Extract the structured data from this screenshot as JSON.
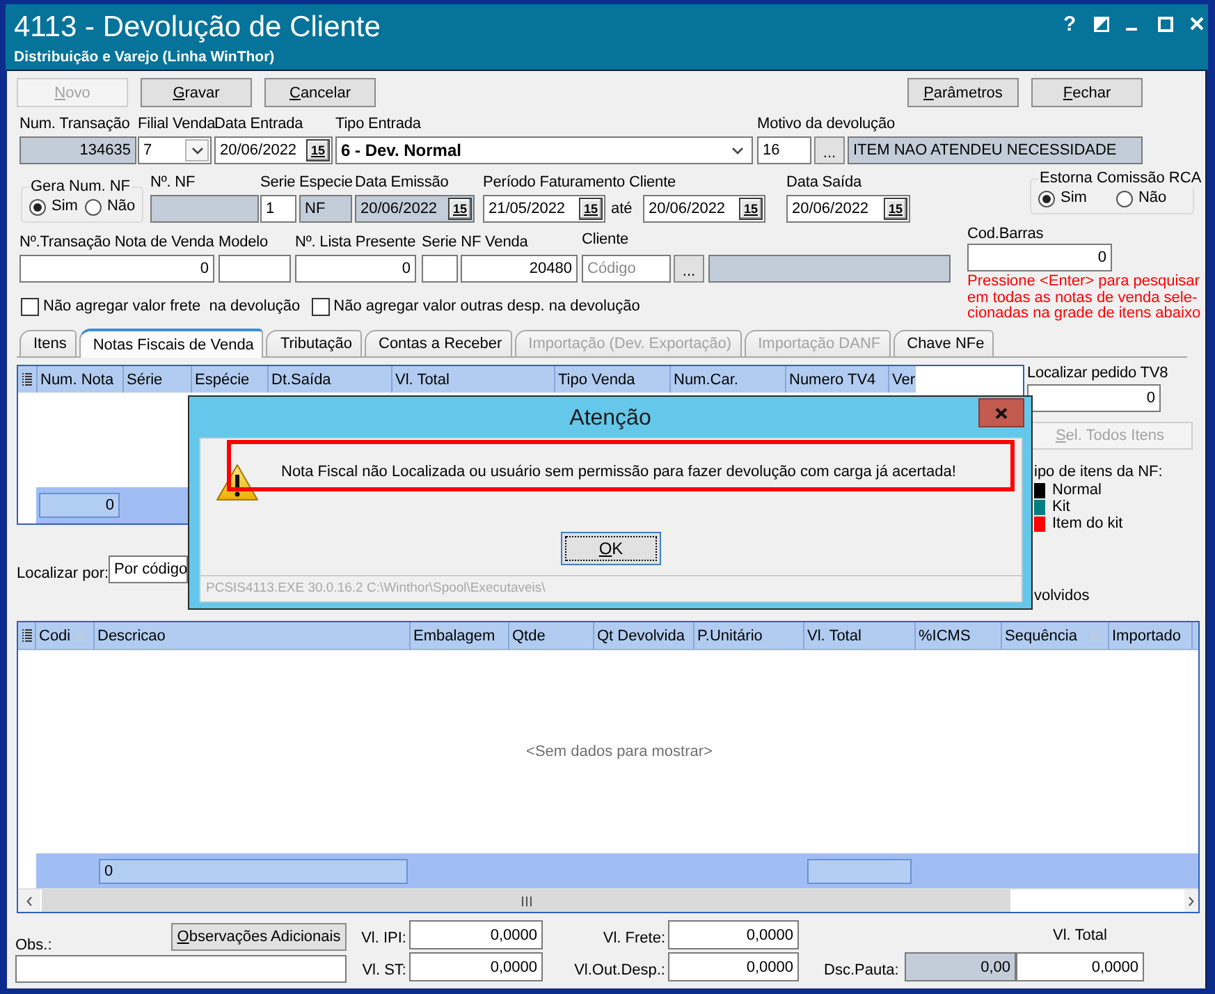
{
  "window": {
    "title": "4113 - Devolução de Cliente",
    "subtitle": "Distribuição e Varejo (Linha WinThor)",
    "controls": [
      {
        "kind": "help",
        "glyph": "?"
      },
      {
        "kind": "contrast"
      },
      {
        "kind": "minimize"
      },
      {
        "kind": "maximize"
      },
      {
        "kind": "close"
      }
    ]
  },
  "toolbar": {
    "left": [
      {
        "label": "Novo",
        "disabled": true,
        "mnemonic": true
      },
      {
        "label": "Gravar",
        "disabled": false,
        "mnemonic": true
      },
      {
        "label": "Cancelar",
        "disabled": false,
        "mnemonic": true
      }
    ],
    "right": [
      {
        "label": "Parâmetros",
        "disabled": false,
        "mnemonic": true
      },
      {
        "label": "Fechar",
        "disabled": false,
        "mnemonic": true
      }
    ]
  },
  "document": {
    "transaction": {
      "label": "Num. Transação",
      "value": "134635",
      "readonly": true
    },
    "branch": {
      "label": "Filial Venda",
      "value": "7"
    },
    "entry_date": {
      "label": "Data Entrada",
      "value": "20/06/2022",
      "calendar": "15"
    },
    "entry_type": {
      "label": "Tipo Entrada",
      "value": "6 - Dev. Normal"
    },
    "reason": {
      "label": "Motivo da devolução",
      "code": "16",
      "button": "...",
      "description": "ITEM NAO ATENDEU NECESSIDADE"
    }
  },
  "invoice": {
    "generate_number": {
      "title": "Gera Num. NF",
      "options": [
        {
          "label": "Sim",
          "selected": true
        },
        {
          "label": "Não",
          "selected": false
        }
      ]
    },
    "number": {
      "label": "Nº. NF",
      "readonly": true
    },
    "series": {
      "label": "Serie",
      "value": "1"
    },
    "species": {
      "label": "Especie",
      "value": "NF",
      "readonly": true
    },
    "issue_date": {
      "label": "Data Emissão",
      "value": "20/06/2022",
      "calendar": "15",
      "readonly": true
    },
    "billing_period": {
      "label": "Período Faturamento Cliente",
      "from": {
        "value": "21/05/2022",
        "calendar": "15"
      },
      "separator": "até",
      "to": {
        "value": "20/06/2022",
        "calendar": "15"
      }
    },
    "exit_date": {
      "label": "Data Saída",
      "value": "20/06/2022",
      "calendar": "15"
    },
    "reverse_commission": {
      "title": "Estorna Comissão RCA",
      "options": [
        {
          "label": "Sim",
          "selected": true
        },
        {
          "label": "Não",
          "selected": false
        }
      ]
    }
  },
  "sale": {
    "transaction": {
      "label": "Nº.Transação Nota de Venda",
      "value": "0"
    },
    "model": {
      "label": "Modelo"
    },
    "gift_list": {
      "label": "Nº. Lista Presente",
      "value": "0"
    },
    "sale_invoice": {
      "label": "Serie NF Venda",
      "value": "20480"
    },
    "customer": {
      "label": "Cliente",
      "placeholder": "Código",
      "button": "..."
    }
  },
  "barcode": {
    "label": "Cod.Barras",
    "value": "0",
    "hint": [
      "Pressione <Enter> para pesquisar",
      "em todas as notas de venda sele-",
      "cionadas na grade de itens abaixo"
    ]
  },
  "options": [
    {
      "label": "Não agregar valor frete  na devolução",
      "checked": false
    },
    {
      "label": "Não agregar valor outras desp. na devolução",
      "checked": false
    }
  ],
  "tabs": [
    {
      "label": "Itens",
      "selected": false,
      "disabled": false
    },
    {
      "label": "Notas Fiscais de Venda",
      "selected": true,
      "disabled": false
    },
    {
      "label": "Tributação",
      "selected": false,
      "disabled": false
    },
    {
      "label": "Contas a Receber",
      "selected": false,
      "disabled": false
    },
    {
      "label": "Importação (Dev. Exportação)",
      "selected": false,
      "disabled": true
    },
    {
      "label": "Importação DANF",
      "selected": false,
      "disabled": true
    },
    {
      "label": "Chave NFe",
      "selected": false,
      "disabled": false
    }
  ],
  "invoices_grid": {
    "columns": [
      "Num. Nota",
      "Série",
      "Espécie",
      "Dt.Saída",
      "Vl. Total",
      "Tipo Venda",
      "Num.Car.",
      "Numero TV4",
      "Ver"
    ],
    "footer_value": "0"
  },
  "side_panel": {
    "tv8_search": {
      "label": "Localizar pedido TV8",
      "value": "0"
    },
    "select_all": {
      "label": "Sel. Todos Itens",
      "disabled": true,
      "mnemonic": true
    },
    "legend": {
      "title": "ipo de itens da NF:",
      "items": [
        {
          "label": "Normal",
          "color": "#000000"
        },
        {
          "label": "Kit",
          "color": "#008080"
        },
        {
          "label": "Item do kit",
          "color": "#ff0000"
        }
      ]
    },
    "note": "volvidos"
  },
  "search_by": {
    "label": "Localizar por:",
    "value": "Por código"
  },
  "dialog": {
    "title": "Atenção",
    "message": "Nota Fiscal não Localizada ou usuário sem permissão para fazer devolução com carga já acertada!",
    "highlighted": true,
    "buttons": [
      {
        "label": "OK",
        "focused": true,
        "mnemonic": true
      }
    ],
    "footer": "PCSIS4113.EXE 30.0.16.2 C:\\Winthor\\Spool\\Executaveis\\"
  },
  "items_grid": {
    "columns": [
      {
        "label": "Codi",
        "sorted": true
      },
      {
        "label": "Descricao"
      },
      {
        "label": "Embalagem"
      },
      {
        "label": "Qtde"
      },
      {
        "label": "Qt Devolvida"
      },
      {
        "label": "P.Unitário"
      },
      {
        "label": "Vl. Total"
      },
      {
        "label": "%ICMS"
      },
      {
        "label": "Sequência",
        "sorted": true
      },
      {
        "label": "Importado"
      }
    ],
    "empty_text": "<Sem dados para mostrar>",
    "footer_value": "0"
  },
  "totals": {
    "notes": {
      "label": "Obs.:",
      "button": {
        "label": "Observações Adicionais",
        "mnemonic": true
      }
    },
    "ipi": {
      "label": "Vl. IPI:",
      "value": "0,0000"
    },
    "st": {
      "label": "Vl. ST:",
      "value": "0,0000"
    },
    "freight": {
      "label": "Vl. Frete:",
      "value": "0,0000"
    },
    "other_expenses": {
      "label": "Vl.Out.Desp.:",
      "value": "0,0000"
    },
    "total": {
      "label": "Vl. Total",
      "value": "0,0000"
    },
    "guideline_discount": {
      "label": "Dsc.Pauta:",
      "value": "0,00",
      "readonly": true
    }
  }
}
